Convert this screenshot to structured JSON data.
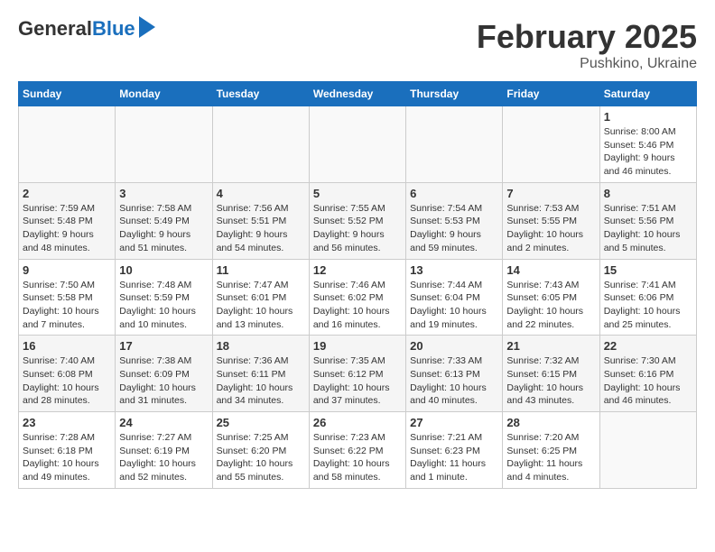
{
  "header": {
    "logo_general": "General",
    "logo_blue": "Blue",
    "month_title": "February 2025",
    "location": "Pushkino, Ukraine"
  },
  "calendar": {
    "days_of_week": [
      "Sunday",
      "Monday",
      "Tuesday",
      "Wednesday",
      "Thursday",
      "Friday",
      "Saturday"
    ],
    "weeks": [
      [
        {
          "day": "",
          "info": ""
        },
        {
          "day": "",
          "info": ""
        },
        {
          "day": "",
          "info": ""
        },
        {
          "day": "",
          "info": ""
        },
        {
          "day": "",
          "info": ""
        },
        {
          "day": "",
          "info": ""
        },
        {
          "day": "1",
          "info": "Sunrise: 8:00 AM\nSunset: 5:46 PM\nDaylight: 9 hours and 46 minutes."
        }
      ],
      [
        {
          "day": "2",
          "info": "Sunrise: 7:59 AM\nSunset: 5:48 PM\nDaylight: 9 hours and 48 minutes."
        },
        {
          "day": "3",
          "info": "Sunrise: 7:58 AM\nSunset: 5:49 PM\nDaylight: 9 hours and 51 minutes."
        },
        {
          "day": "4",
          "info": "Sunrise: 7:56 AM\nSunset: 5:51 PM\nDaylight: 9 hours and 54 minutes."
        },
        {
          "day": "5",
          "info": "Sunrise: 7:55 AM\nSunset: 5:52 PM\nDaylight: 9 hours and 56 minutes."
        },
        {
          "day": "6",
          "info": "Sunrise: 7:54 AM\nSunset: 5:53 PM\nDaylight: 9 hours and 59 minutes."
        },
        {
          "day": "7",
          "info": "Sunrise: 7:53 AM\nSunset: 5:55 PM\nDaylight: 10 hours and 2 minutes."
        },
        {
          "day": "8",
          "info": "Sunrise: 7:51 AM\nSunset: 5:56 PM\nDaylight: 10 hours and 5 minutes."
        }
      ],
      [
        {
          "day": "9",
          "info": "Sunrise: 7:50 AM\nSunset: 5:58 PM\nDaylight: 10 hours and 7 minutes."
        },
        {
          "day": "10",
          "info": "Sunrise: 7:48 AM\nSunset: 5:59 PM\nDaylight: 10 hours and 10 minutes."
        },
        {
          "day": "11",
          "info": "Sunrise: 7:47 AM\nSunset: 6:01 PM\nDaylight: 10 hours and 13 minutes."
        },
        {
          "day": "12",
          "info": "Sunrise: 7:46 AM\nSunset: 6:02 PM\nDaylight: 10 hours and 16 minutes."
        },
        {
          "day": "13",
          "info": "Sunrise: 7:44 AM\nSunset: 6:04 PM\nDaylight: 10 hours and 19 minutes."
        },
        {
          "day": "14",
          "info": "Sunrise: 7:43 AM\nSunset: 6:05 PM\nDaylight: 10 hours and 22 minutes."
        },
        {
          "day": "15",
          "info": "Sunrise: 7:41 AM\nSunset: 6:06 PM\nDaylight: 10 hours and 25 minutes."
        }
      ],
      [
        {
          "day": "16",
          "info": "Sunrise: 7:40 AM\nSunset: 6:08 PM\nDaylight: 10 hours and 28 minutes."
        },
        {
          "day": "17",
          "info": "Sunrise: 7:38 AM\nSunset: 6:09 PM\nDaylight: 10 hours and 31 minutes."
        },
        {
          "day": "18",
          "info": "Sunrise: 7:36 AM\nSunset: 6:11 PM\nDaylight: 10 hours and 34 minutes."
        },
        {
          "day": "19",
          "info": "Sunrise: 7:35 AM\nSunset: 6:12 PM\nDaylight: 10 hours and 37 minutes."
        },
        {
          "day": "20",
          "info": "Sunrise: 7:33 AM\nSunset: 6:13 PM\nDaylight: 10 hours and 40 minutes."
        },
        {
          "day": "21",
          "info": "Sunrise: 7:32 AM\nSunset: 6:15 PM\nDaylight: 10 hours and 43 minutes."
        },
        {
          "day": "22",
          "info": "Sunrise: 7:30 AM\nSunset: 6:16 PM\nDaylight: 10 hours and 46 minutes."
        }
      ],
      [
        {
          "day": "23",
          "info": "Sunrise: 7:28 AM\nSunset: 6:18 PM\nDaylight: 10 hours and 49 minutes."
        },
        {
          "day": "24",
          "info": "Sunrise: 7:27 AM\nSunset: 6:19 PM\nDaylight: 10 hours and 52 minutes."
        },
        {
          "day": "25",
          "info": "Sunrise: 7:25 AM\nSunset: 6:20 PM\nDaylight: 10 hours and 55 minutes."
        },
        {
          "day": "26",
          "info": "Sunrise: 7:23 AM\nSunset: 6:22 PM\nDaylight: 10 hours and 58 minutes."
        },
        {
          "day": "27",
          "info": "Sunrise: 7:21 AM\nSunset: 6:23 PM\nDaylight: 11 hours and 1 minute."
        },
        {
          "day": "28",
          "info": "Sunrise: 7:20 AM\nSunset: 6:25 PM\nDaylight: 11 hours and 4 minutes."
        },
        {
          "day": "",
          "info": ""
        }
      ]
    ]
  }
}
